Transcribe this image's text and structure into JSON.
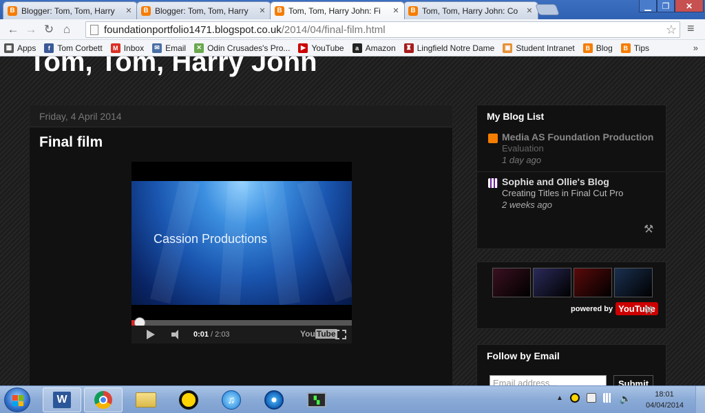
{
  "browser": {
    "tabs": [
      {
        "label": "Blogger: Tom, Tom, Harry",
        "active": false
      },
      {
        "label": "Blogger: Tom, Tom, Harry",
        "active": false
      },
      {
        "label": "Tom, Tom, Harry John: Fi",
        "active": true
      },
      {
        "label": "Tom, Tom, Harry John: Co",
        "active": false
      }
    ],
    "close_glyph": "✕",
    "url_host": "foundationportfolio1471.blogspot.co.uk",
    "url_path": "/2014/04/final-film.html",
    "bookmarks": [
      {
        "label": "Apps",
        "icon": "apps-grid-icon",
        "color": "#555555",
        "glyph": "▦"
      },
      {
        "label": "Tom Corbett",
        "icon": "facebook-icon",
        "color": "#3b5998",
        "glyph": "f"
      },
      {
        "label": "Inbox",
        "icon": "gmail-icon",
        "color": "#d93025",
        "glyph": "M"
      },
      {
        "label": "Email",
        "icon": "mail-icon",
        "color": "#4a6fa5",
        "glyph": "✉"
      },
      {
        "label": "Odin Crusades's Pro...",
        "icon": "xbox-icon",
        "color": "#6aa84f",
        "glyph": "✕"
      },
      {
        "label": "YouTube",
        "icon": "youtube-icon",
        "color": "#cc0000",
        "glyph": "▶"
      },
      {
        "label": "Amazon",
        "icon": "amazon-icon",
        "color": "#222222",
        "glyph": "a"
      },
      {
        "label": "Lingfield Notre Dame",
        "icon": "school-crest-icon",
        "color": "#a61c1c",
        "glyph": "♜"
      },
      {
        "label": "Student Intranet",
        "icon": "intranet-icon",
        "color": "#e69138",
        "glyph": "▣"
      },
      {
        "label": "Blog",
        "icon": "blogger-icon",
        "color": "#f57d00",
        "glyph": "B"
      },
      {
        "label": "Tips",
        "icon": "blogger-icon",
        "color": "#f57d00",
        "glyph": "B"
      }
    ],
    "more_glyph": "»"
  },
  "blog": {
    "title": "Tom, Tom, Harry John",
    "post": {
      "date": "Friday, 4 April 2014",
      "title": "Final film",
      "video": {
        "caption": "Cassion Productions",
        "current_time": "0:01",
        "duration": "/ 2:03",
        "progress": 0.02,
        "logo_you": "You",
        "logo_tube": "Tube"
      }
    }
  },
  "sidebar": {
    "blog_list_title": "My Blog List",
    "blog_list": [
      {
        "name": "Media AS Foundation Production",
        "post": "Evaluation",
        "time": "1 day ago",
        "icon": "blogger-icon"
      },
      {
        "name": "Sophie and Ollie's Blog",
        "post": "Creating Titles in Final Cut Pro",
        "time": "2 weeks ago",
        "icon": "grid-favicon-icon"
      }
    ],
    "youtube_widget": {
      "powered_by": "powered by",
      "badge_you": "You",
      "badge_tube": "Tube",
      "thumb_colors": [
        "#3a1020",
        "#2a2a5a",
        "#5a0a0a",
        "#1a3050"
      ]
    },
    "follow_title": "Follow by Email",
    "email_placeholder": "Email address...",
    "submit_label": "Submit"
  },
  "taskbar": {
    "time": "18:01",
    "date": "04/04/2014",
    "tray_arrow": "▲"
  }
}
